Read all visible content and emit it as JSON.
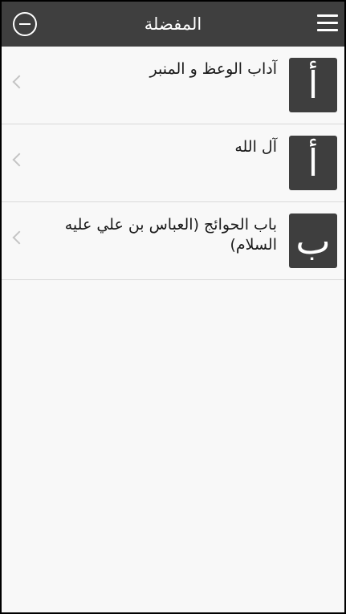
{
  "header": {
    "title": "المفضلة"
  },
  "favorites": [
    {
      "letter": "أ",
      "title": "آداب الوعظ و المنبر"
    },
    {
      "letter": "أ",
      "title": "آل الله"
    },
    {
      "letter": "ب",
      "title": "باب الحوائج (العباس بن علي عليه السلام)"
    }
  ],
  "colors": {
    "header_bg": "#3f3f3f",
    "tile_bg": "#3e3e3e",
    "page_bg": "#f8f8f8"
  }
}
